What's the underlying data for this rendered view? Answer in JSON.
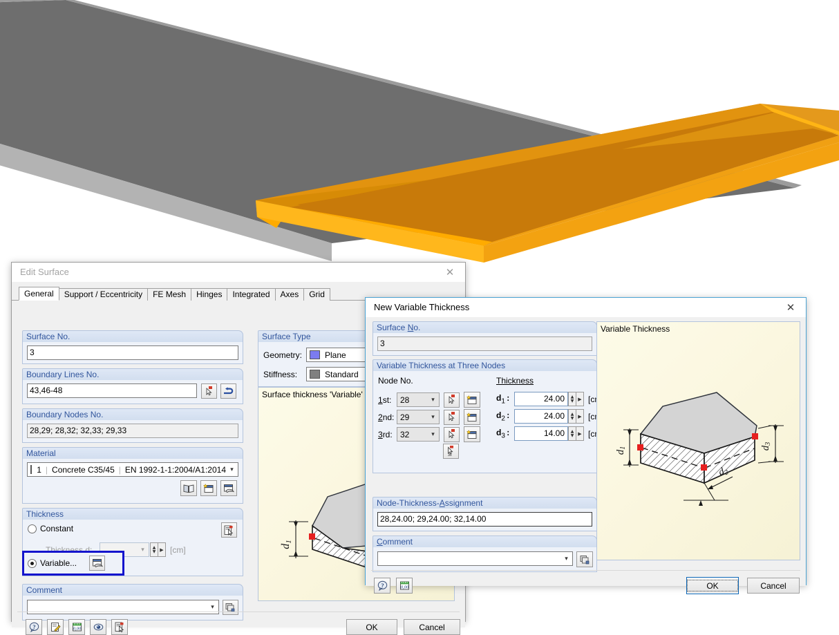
{
  "viewport": {
    "name": "3d-slab-view",
    "description": "3D rendered slab with grey body and orange highlighted surface",
    "colors": {
      "grey_top": "#6f6f6f",
      "grey_top_light": "#9a9a9a",
      "grey_edge": "#b5b5b5",
      "orange_top": "#c87a0a",
      "orange_side": "#f0a013",
      "orange_bright": "#ffab00",
      "orange_dark": "#d78b06"
    }
  },
  "edit_surface": {
    "title": "Edit Surface",
    "close_icon": "✕",
    "tabs": [
      {
        "label": "General",
        "selected": true
      },
      {
        "label": "Support / Eccentricity",
        "selected": false
      },
      {
        "label": "FE Mesh",
        "selected": false
      },
      {
        "label": "Hinges",
        "selected": false
      },
      {
        "label": "Integrated",
        "selected": false
      },
      {
        "label": "Axes",
        "selected": false
      },
      {
        "label": "Grid",
        "selected": false
      }
    ],
    "surface_no": {
      "header": "Surface No.",
      "value": "3"
    },
    "boundary_lines": {
      "header": "Boundary Lines No.",
      "value": "43,46-48"
    },
    "boundary_nodes": {
      "header": "Boundary Nodes No.",
      "value": "28,29; 28,32; 32,33; 29,33"
    },
    "material": {
      "header": "Material",
      "number": "1",
      "name": "Concrete C35/45",
      "standard": "EN 1992-1-1:2004/A1:2014",
      "color": "#7d7d7d"
    },
    "thickness": {
      "header": "Thickness",
      "constant_label": "Constant",
      "constant_selected": false,
      "thickness_d_label": "Thickness d:",
      "thickness_d_value": "",
      "thickness_unit": "[cm]",
      "variable_label": "Variable...",
      "variable_selected": true,
      "highlight_color": "#1414cd"
    },
    "comment": {
      "header": "Comment",
      "value": ""
    },
    "surface_type": {
      "header": "Surface Type",
      "geometry_label": "Geometry:",
      "geometry_value": "Plane",
      "geometry_color": "#7b7bf0",
      "stiffness_label": "Stiffness:",
      "stiffness_value": "Standard",
      "stiffness_color": "#808080"
    },
    "preview": {
      "title": "Surface thickness 'Variable'",
      "dim_label": "d1"
    },
    "footer": {
      "ok": "OK",
      "cancel": "Cancel",
      "icons": [
        "help-icon",
        "edit-note-icon",
        "units-icon",
        "view-icon",
        "pick-icon"
      ]
    }
  },
  "new_variable_thickness": {
    "title": "New Variable Thickness",
    "close_icon": "✕",
    "surface_no": {
      "header": "Surface No.",
      "value": "3"
    },
    "nodes_group": {
      "header": "Variable Thickness at Three Nodes",
      "node_col_label": "Node No.",
      "thickness_col_label": "Thickness",
      "unit": "[cm]",
      "rows": [
        {
          "ordinal": "1st:",
          "node": "28",
          "d_label": "d",
          "d_sub": "1",
          "thickness": "24.00"
        },
        {
          "ordinal": "2nd:",
          "node": "29",
          "d_label": "d",
          "d_sub": "2",
          "thickness": "24.00"
        },
        {
          "ordinal": "3rd:",
          "node": "32",
          "d_label": "d",
          "d_sub": "3",
          "thickness": "14.00"
        }
      ],
      "pick3_icon": "pick-three-nodes-icon"
    },
    "assignment": {
      "header": "Node-Thickness-Assignment",
      "value": "28,24.00; 29,24.00; 32,14.00"
    },
    "comment": {
      "header": "Comment",
      "value": ""
    },
    "preview": {
      "title": "Variable Thickness",
      "labels": [
        "d1",
        "d2",
        "d3"
      ],
      "node_marker_color": "#e62020"
    },
    "footer": {
      "ok": "OK",
      "cancel": "Cancel",
      "icons": [
        "help-icon",
        "units-icon"
      ]
    }
  }
}
